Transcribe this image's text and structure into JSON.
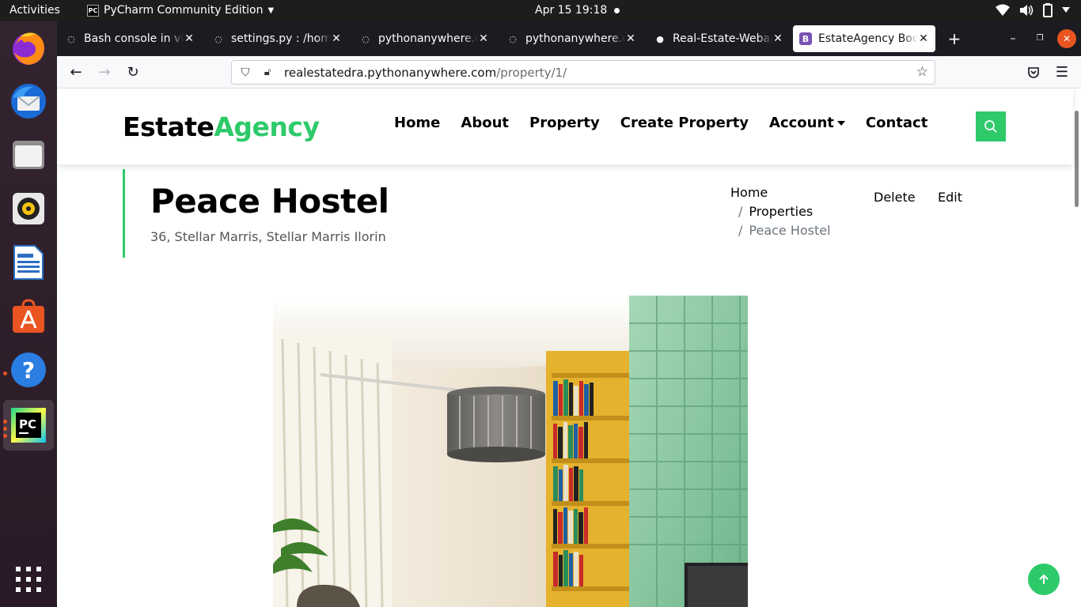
{
  "system": {
    "activities": "Activities",
    "app_name": "PyCharm Community Edition",
    "clock": "Apr 15  19:18"
  },
  "dock": {
    "items": [
      "firefox-icon",
      "thunderbird-icon",
      "files-icon",
      "rhythmbox-icon",
      "writer-icon",
      "software-icon",
      "help-icon",
      "pycharm-icon"
    ],
    "apps_grid": "show-apps-icon"
  },
  "browser": {
    "tabs": [
      {
        "title": "Bash console in virt"
      },
      {
        "title": "settings.py : /home/"
      },
      {
        "title": "pythonanywhere.co"
      },
      {
        "title": "pythonanywhere.co"
      },
      {
        "title": "Real-Estate-Webap"
      },
      {
        "title": "EstateAgency Boot"
      }
    ],
    "new_tab": "+",
    "url_host": "realestatedra.pythonanywhere.com",
    "url_path": "/property/1/"
  },
  "site": {
    "brand_main": "Estate",
    "brand_accent": "Agency",
    "menu": [
      "Home",
      "About",
      "Property",
      "Create Property",
      "Account",
      "Contact"
    ],
    "accent_color": "#2eca6a"
  },
  "property": {
    "title": "Peace Hostel",
    "address": "36, Stellar Marris, Stellar Marris Ilorin"
  },
  "breadcrumb": {
    "home": "Home",
    "sep": "/",
    "properties": "Properties",
    "current": "Peace Hostel"
  },
  "actions": {
    "delete": "Delete",
    "edit": "Edit"
  }
}
